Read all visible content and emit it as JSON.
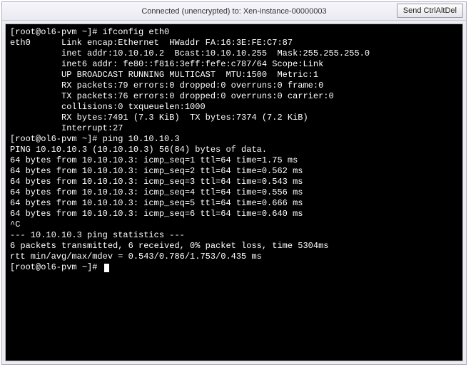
{
  "titlebar": {
    "text": "Connected (unencrypted) to: Xen-instance-00000003",
    "button_label": "Send CtrlAltDel"
  },
  "terminal": {
    "lines": [
      "[root@ol6-pvm ~]# ifconfig eth0",
      "eth0      Link encap:Ethernet  HWaddr FA:16:3E:FE:C7:87",
      "          inet addr:10.10.10.2  Bcast:10.10.10.255  Mask:255.255.255.0",
      "          inet6 addr: fe80::f816:3eff:fefe:c787/64 Scope:Link",
      "          UP BROADCAST RUNNING MULTICAST  MTU:1500  Metric:1",
      "          RX packets:79 errors:0 dropped:0 overruns:0 frame:0",
      "          TX packets:76 errors:0 dropped:0 overruns:0 carrier:0",
      "          collisions:0 txqueuelen:1000",
      "          RX bytes:7491 (7.3 KiB)  TX bytes:7374 (7.2 KiB)",
      "          Interrupt:27",
      "",
      "[root@ol6-pvm ~]# ping 10.10.10.3",
      "PING 10.10.10.3 (10.10.10.3) 56(84) bytes of data.",
      "64 bytes from 10.10.10.3: icmp_seq=1 ttl=64 time=1.75 ms",
      "64 bytes from 10.10.10.3: icmp_seq=2 ttl=64 time=0.562 ms",
      "64 bytes from 10.10.10.3: icmp_seq=3 ttl=64 time=0.543 ms",
      "64 bytes from 10.10.10.3: icmp_seq=4 ttl=64 time=0.556 ms",
      "64 bytes from 10.10.10.3: icmp_seq=5 ttl=64 time=0.666 ms",
      "64 bytes from 10.10.10.3: icmp_seq=6 ttl=64 time=0.640 ms",
      "^C",
      "--- 10.10.10.3 ping statistics ---",
      "6 packets transmitted, 6 received, 0% packet loss, time 5304ms",
      "rtt min/avg/max/mdev = 0.543/0.786/1.753/0.435 ms",
      "[root@ol6-pvm ~]# "
    ]
  }
}
